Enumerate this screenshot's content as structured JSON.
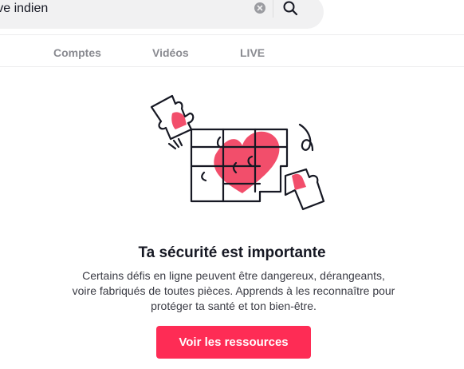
{
  "search": {
    "query": "rêve indien",
    "clear_icon": "clear-circle-icon",
    "search_icon": "magnifier-icon"
  },
  "tabs": [
    {
      "label": "Comptes"
    },
    {
      "label": "Vidéos"
    },
    {
      "label": "LIVE"
    }
  ],
  "illustration": {
    "icon": "puzzle-heart-illustration",
    "heart_color": "#f24e6b"
  },
  "safety": {
    "title": "Ta sécurité est importante",
    "description_lines": [
      "Certains défis en ligne peuvent être dangereux, dérangeants,",
      "voire fabriqués de toutes pièces. Apprends à les reconnaître pour",
      "protéger ta santé et ton bien-être."
    ],
    "button_label": "Voir les ressources"
  },
  "colors": {
    "accent": "#fe2c55",
    "tab_text": "#8a8b91",
    "search_bg": "#f1f1f2"
  }
}
